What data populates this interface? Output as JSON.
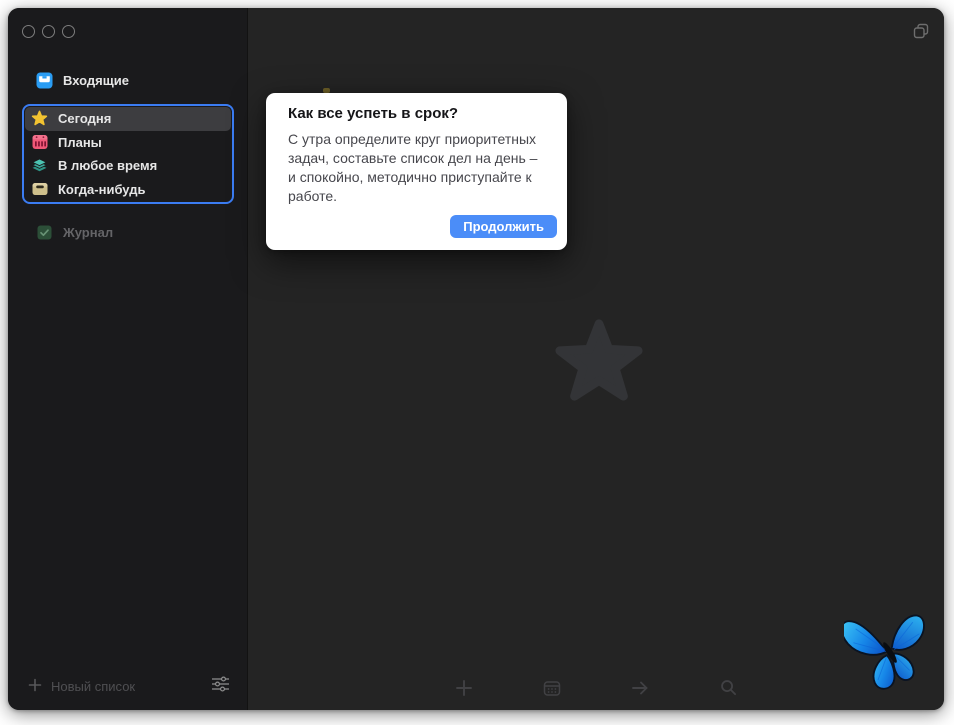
{
  "window": {
    "traffic_lights": [
      "close",
      "minimize",
      "zoom"
    ]
  },
  "colors": {
    "accent_blue": "#4b8df8",
    "focus_ring_blue": "#3b7cf2",
    "sidebar_bg": "#1a1a1c",
    "main_bg": "#242424",
    "inbox_blue": "#2a9df4",
    "today_star_yellow": "#f2c331",
    "plans_calendar_pink": "#ef5878",
    "anytime_layers_teal": "#4cc3b2",
    "someday_box_khaki": "#cfc08c",
    "logbook_green": "#2c4f38"
  },
  "sidebar": {
    "inbox": {
      "label": "Входящие",
      "icon": "inbox-icon"
    },
    "focus_group": [
      {
        "label": "Сегодня",
        "icon": "star-icon",
        "selected": true
      },
      {
        "label": "Планы",
        "icon": "calendar-icon",
        "selected": false
      },
      {
        "label": "В любое время",
        "icon": "layers-icon",
        "selected": false
      },
      {
        "label": "Когда-нибудь",
        "icon": "box-icon",
        "selected": false
      }
    ],
    "logbook": {
      "label": "Журнал",
      "icon": "journal-check-icon"
    },
    "footer": {
      "new_list_label": "Новый список",
      "settings_icon": "sliders-icon"
    }
  },
  "popover": {
    "title": "Как все успеть в срок?",
    "body": "С утра определите круг приоритетных задач, составьте список дел на день – и спокойно, методично приступайте к работе.",
    "button_label": "Продолжить"
  },
  "main_toolbar": {
    "icons": [
      "add",
      "calendar",
      "go-to",
      "search"
    ]
  }
}
